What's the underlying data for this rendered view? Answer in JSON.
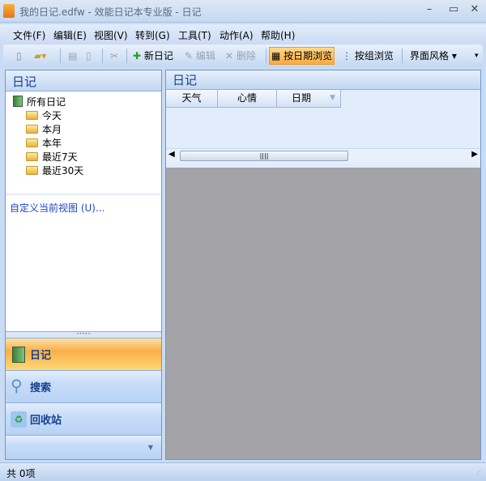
{
  "window": {
    "title": "我的日记.edfw - 效能日记本专业版 - 日记",
    "minimize": "–",
    "maximize": "▭",
    "close": "✕"
  },
  "menu": [
    "文件(F)",
    "编辑(E)",
    "视图(V)",
    "转到(G)",
    "工具(T)",
    "动作(A)",
    "帮助(H)"
  ],
  "toolbar": {
    "new_diary": "新日记",
    "edit": "编辑",
    "delete": "删除",
    "by_date": "按日期浏览",
    "by_group": "按组浏览",
    "theme": "界面风格"
  },
  "left_panel": {
    "title": "日记",
    "tree_root": "所有日记",
    "tree_items": [
      "今天",
      "本月",
      "本年",
      "最近7天",
      "最近30天"
    ],
    "customize_link": "自定义当前视图 (U)..."
  },
  "nav": {
    "diary": "日记",
    "search": "搜索",
    "recycle": "回收站"
  },
  "right_panel": {
    "title": "日记",
    "columns": [
      "天气",
      "心情",
      "日期"
    ]
  },
  "status": {
    "count": "共 0项"
  }
}
